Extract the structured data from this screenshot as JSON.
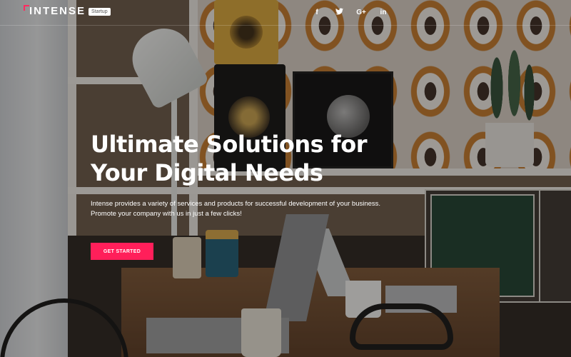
{
  "brand": {
    "name": "INTENSE",
    "badge": "Startup",
    "accent_color": "#ff1f5a"
  },
  "social": [
    {
      "icon": "facebook-icon",
      "glyph": "f"
    },
    {
      "icon": "twitter-icon",
      "glyph": "🐦"
    },
    {
      "icon": "google-plus-icon",
      "glyph": "G+"
    },
    {
      "icon": "linkedin-icon",
      "glyph": "in"
    }
  ],
  "hero": {
    "title_line1": "Ultimate Solutions for",
    "title_line2": "Your Digital Needs",
    "description_line1": "Intense provides a variety of services and products for successful development of your business.",
    "description_line2": "Promote your company with us in just a few clicks!",
    "cta_label": "GET STARTED"
  }
}
